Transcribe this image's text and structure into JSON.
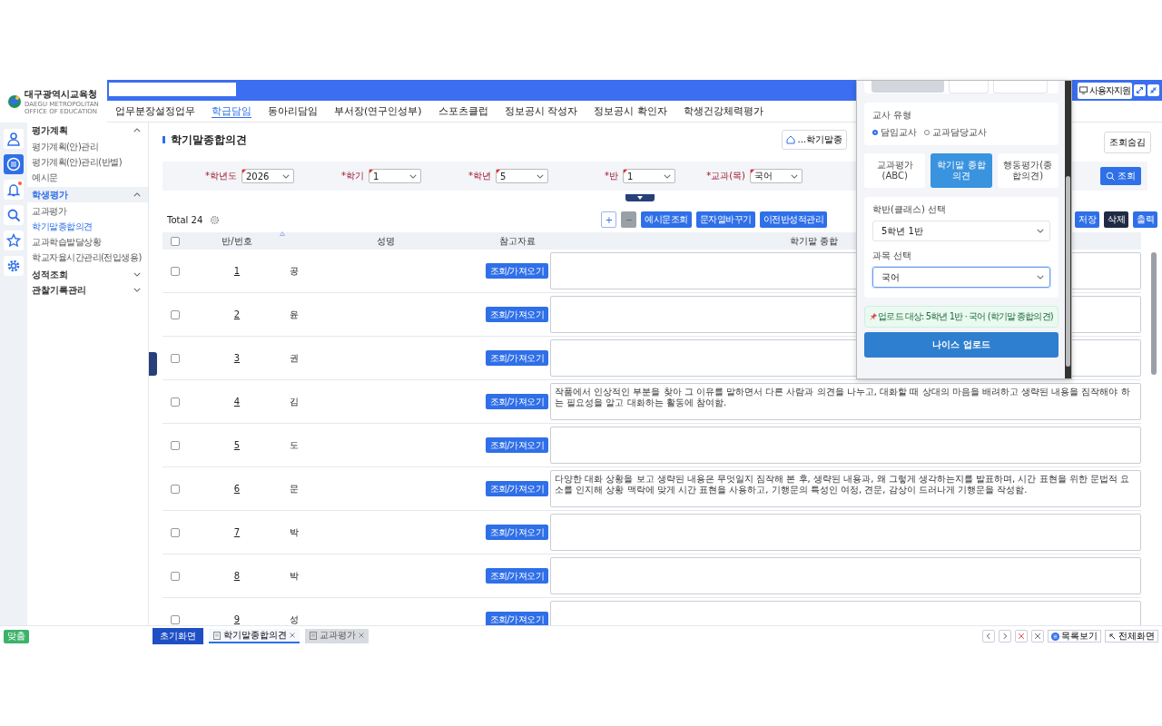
{
  "header": {
    "logo_name": "대구광역시교육청",
    "logo_subtitle": "DAEGU METROPOLITAN OFFICE OF EDUCATION",
    "support_button": "사용자지원"
  },
  "nav": [
    {
      "label": "업무분장설정업무",
      "selected": false
    },
    {
      "label": "학급담임",
      "selected": true
    },
    {
      "label": "동아리담임",
      "selected": false
    },
    {
      "label": "부서장(연구인성부)",
      "selected": false
    },
    {
      "label": "스포츠클럽",
      "selected": false
    },
    {
      "label": "정보공시 작성자",
      "selected": false
    },
    {
      "label": "정보공시 확인자",
      "selected": false
    },
    {
      "label": "학생건강체력평가",
      "selected": false
    }
  ],
  "rail": [
    {
      "kind": "person",
      "selected": false,
      "alert": false
    },
    {
      "kind": "list",
      "selected": true,
      "alert": false
    },
    {
      "kind": "bell",
      "selected": false,
      "alert": true
    },
    {
      "kind": "search",
      "selected": false,
      "alert": false
    },
    {
      "kind": "star",
      "selected": false,
      "alert": false
    },
    {
      "kind": "gear",
      "selected": false,
      "alert": false
    }
  ],
  "sidebar": [
    {
      "label": "평가계획",
      "expanded": true,
      "selected": false,
      "items": [
        {
          "label": "평가계획(안)관리",
          "selected": false
        },
        {
          "label": "평가계획(안)관리(반별)",
          "selected": false
        },
        {
          "label": "예시문",
          "selected": false
        }
      ]
    },
    {
      "label": "학생평가",
      "expanded": true,
      "selected": true,
      "items": [
        {
          "label": "교과평가",
          "selected": false
        },
        {
          "label": "학기말종합의견",
          "selected": true
        },
        {
          "label": "교과학습발달상황",
          "selected": false
        },
        {
          "label": "학교자율시간관리(전입생용)",
          "selected": false
        }
      ]
    },
    {
      "label": "성적조회",
      "expanded": false,
      "selected": false
    },
    {
      "label": "관찰기록관리",
      "expanded": false,
      "selected": false
    }
  ],
  "page": {
    "title": "학기말종합의견",
    "breadcrumb": "...학기말종",
    "hide_button": "조회숨김",
    "search_button": "조회",
    "filters": [
      {
        "label": "*학년도",
        "value": "2026"
      },
      {
        "label": "*학기",
        "value": "1"
      },
      {
        "label": "*학년",
        "value": "5"
      },
      {
        "label": "*반",
        "value": "1"
      },
      {
        "label": "*교과(목)",
        "value": "국어"
      }
    ]
  },
  "toolbar": {
    "total": "Total 24",
    "left_buttons": [
      {
        "label": "+",
        "kind": "outline"
      },
      {
        "label": "−",
        "kind": "grey"
      },
      {
        "label": "예시문조회",
        "kind": "primary"
      },
      {
        "label": "문자열바꾸기",
        "kind": "primary"
      },
      {
        "label": "이전반성적관리",
        "kind": "primary"
      }
    ],
    "right_buttons": [
      {
        "label": "저장",
        "kind": "primary"
      },
      {
        "label": "삭제",
        "kind": "dark"
      },
      {
        "label": "출력",
        "kind": "primary"
      }
    ]
  },
  "table": {
    "select_all_checked": false,
    "columns": [
      "반/번호",
      "성명",
      "참고자료",
      "학기말 종합"
    ],
    "rows": [
      {
        "checked": false,
        "number": "1",
        "name": "공",
        "button": "조회/가져오기"
      },
      {
        "checked": false,
        "number": "2",
        "name": "윤",
        "button": "조회/가져오기"
      },
      {
        "checked": false,
        "number": "3",
        "name": "권",
        "button": "조회/가져오기"
      },
      {
        "checked": false,
        "number": "4",
        "name": "김",
        "button": "조회/가져오기",
        "opinion": "작품에서 인상적인 부분을 찾아 그 이유를 말하면서 다른 사람과 의견을 나누고, 대화할 때 상대의 마음을 배려하고 생략된 내용을 짐작해야 하는 필요성을 알고 대화하는 활동에 참여함."
      },
      {
        "checked": false,
        "number": "5",
        "name": "도",
        "button": "조회/가져오기"
      },
      {
        "checked": false,
        "number": "6",
        "name": "문",
        "button": "조회/가져오기",
        "opinion": "다양한 대화 상황을 보고 생략된 내용은 무엇일지 짐작해 본 후, 생략된 내용과, 왜 그렇게 생각하는지를 발표하며, 시간 표현을 위한 문법적 요소를 인지해 상황 맥락에 맞게 시간 표현을 사용하고, 기행문의 특성인 여정, 견문, 감상이 드러나게 기행문을 작성함."
      },
      {
        "checked": false,
        "number": "7",
        "name": "박",
        "button": "조회/가져오기"
      },
      {
        "checked": false,
        "number": "8",
        "name": "박",
        "button": "조회/가져오기"
      },
      {
        "checked": false,
        "number": "9",
        "name": "성",
        "button": "조회/가져오기"
      }
    ]
  },
  "popup": {
    "teacher_type": {
      "label": "교사 유형",
      "options": [
        {
          "label": "담임교사",
          "selected": true
        },
        {
          "label": "교과담당교사",
          "selected": false
        }
      ]
    },
    "modes": [
      {
        "label": "교과평가(ABC)",
        "selected": false
      },
      {
        "label": "학기말 종합의견",
        "selected": true
      },
      {
        "label": "행동평가(종합의견)",
        "selected": false
      }
    ],
    "class_select": {
      "label": "학반(클래스) 선택",
      "value": "5학년 1반",
      "focused": false
    },
    "subject_select": {
      "label": "과목 선택",
      "value": "국어",
      "focused": true
    },
    "notice": "업로드 대상: 5학년 1반 · 국어 (학기말 종합의견)",
    "upload_button": "나이스 업로드"
  },
  "bottom": {
    "fit_button": "맞춤",
    "home_button": "초기화면",
    "tabs": [
      {
        "label": "학기말종합의견",
        "selected": true
      },
      {
        "label": "교과평가",
        "selected": false
      }
    ],
    "list_button": "목록보기",
    "fullscreen_button": "전체화면"
  }
}
